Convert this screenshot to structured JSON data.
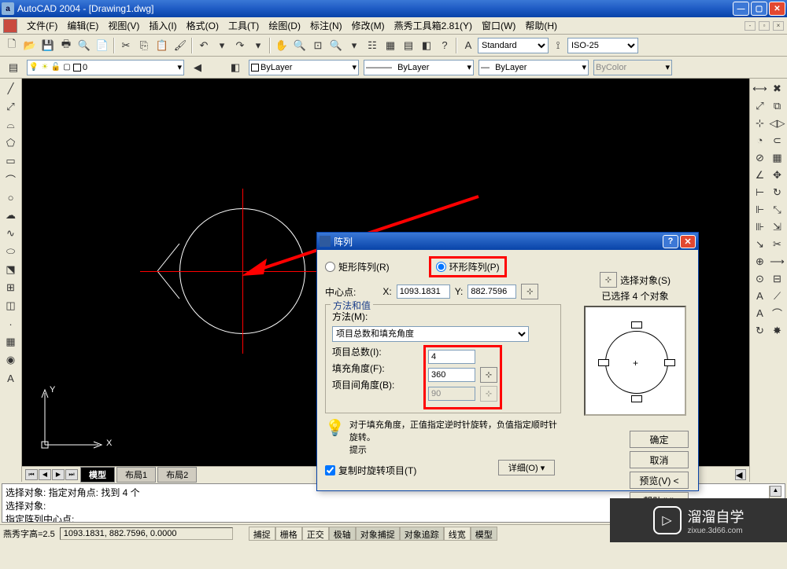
{
  "title": "AutoCAD 2004 - [Drawing1.dwg]",
  "menus": {
    "file": "文件(F)",
    "edit": "编辑(E)",
    "view": "视图(V)",
    "insert": "插入(I)",
    "format": "格式(O)",
    "tools": "工具(T)",
    "draw": "绘图(D)",
    "dim": "标注(N)",
    "modify": "修改(M)",
    "yanxiu": "燕秀工具箱2.81(Y)",
    "window": "窗口(W)",
    "help": "帮助(H)"
  },
  "styles": {
    "text": "Standard",
    "dim": "ISO-25"
  },
  "layer": {
    "current": "0",
    "bylayer": "ByLayer",
    "bycolor": "ByColor"
  },
  "tabs": {
    "model": "模型",
    "layout1": "布局1",
    "layout2": "布局2"
  },
  "cmdlines": {
    "l1": "选择对象: 指定对角点: 找到 4 个",
    "l2": "选择对象:",
    "l3": "指定阵列中心点:"
  },
  "status": {
    "yx": "燕秀字高=2.5",
    "coord": "1093.1831, 882.7596, 0.0000",
    "snap": "捕捉",
    "grid": "栅格",
    "ortho": "正交",
    "polar": "极轴",
    "osnap": "对象捕捉",
    "otrack": "对象追踪",
    "lwt": "线宽",
    "model": "模型"
  },
  "dialog": {
    "title": "阵列",
    "rect": "矩形阵列(R)",
    "polar": "环形阵列(P)",
    "selobj": "选择对象(S)",
    "selcount": "已选择 4 个对象",
    "center": "中心点:",
    "xlbl": "X:",
    "xval": "1093.1831",
    "ylbl": "Y:",
    "yval": "882.7596",
    "mvgroup": "方法和值",
    "method_lbl": "方法(M):",
    "method_val": "项目总数和填充角度",
    "items_lbl": "项目总数(I):",
    "items_val": "4",
    "fill_lbl": "填充角度(F):",
    "fill_val": "360",
    "between_lbl": "项目间角度(B):",
    "between_val": "90",
    "tip": "对于填充角度，正值指定逆时针旋转，负值指定顺时针旋转。",
    "tiplbl": "提示",
    "copy": "复制时旋转项目(T)",
    "detail": "详细(O)  ▾",
    "ok": "确定",
    "cancel": "取消",
    "preview": "预览(V) <",
    "helpbtn": "帮助(H)"
  },
  "ucs": {
    "x": "X",
    "y": "Y"
  },
  "watermark": {
    "main": "溜溜自学",
    "sub": "zixue.3d66.com"
  }
}
